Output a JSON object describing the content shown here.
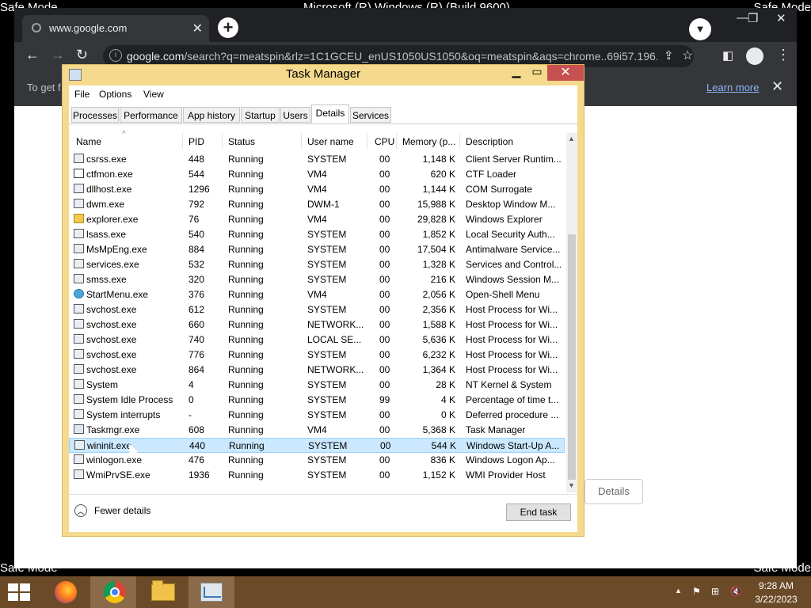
{
  "desktop": {
    "safe_mode": "Safe Mode",
    "build": "Microsoft (R) Windows (R) (Build 9600)"
  },
  "browser": {
    "tab_title": "www.google.com",
    "url_host": "google.com",
    "url_path": "/search?q=meatspin&rlz=1C1GCEU_enUS1050US1050&oq=meatspin&aqs=chrome..69i57.196...",
    "info_text": "To get f",
    "learn_more": "Learn more",
    "details_label": "Details"
  },
  "task_manager": {
    "title": "Task Manager",
    "menu": [
      "File",
      "Options",
      "View"
    ],
    "tabs": [
      "Processes",
      "Performance",
      "App history",
      "Startup",
      "Users",
      "Details",
      "Services"
    ],
    "active_tab": "Details",
    "columns": [
      "Name",
      "PID",
      "Status",
      "User name",
      "CPU",
      "Memory (p...",
      "Description"
    ],
    "rows": [
      {
        "name": "csrss.exe",
        "pid": "448",
        "status": "Running",
        "user": "SYSTEM",
        "cpu": "00",
        "mem": "1,148 K",
        "desc": "Client Server Runtim...",
        "icon": "exe-icon"
      },
      {
        "name": "ctfmon.exe",
        "pid": "544",
        "status": "Running",
        "user": "VM4",
        "cpu": "00",
        "mem": "620 K",
        "desc": "CTF Loader",
        "icon": "pencil-icon"
      },
      {
        "name": "dllhost.exe",
        "pid": "1296",
        "status": "Running",
        "user": "VM4",
        "cpu": "00",
        "mem": "1,144 K",
        "desc": "COM Surrogate",
        "icon": "exe-icon"
      },
      {
        "name": "dwm.exe",
        "pid": "792",
        "status": "Running",
        "user": "DWM-1",
        "cpu": "00",
        "mem": "15,988 K",
        "desc": "Desktop Window M...",
        "icon": "exe-icon"
      },
      {
        "name": "explorer.exe",
        "pid": "76",
        "status": "Running",
        "user": "VM4",
        "cpu": "00",
        "mem": "29,828 K",
        "desc": "Windows Explorer",
        "icon": "folder-icon"
      },
      {
        "name": "lsass.exe",
        "pid": "540",
        "status": "Running",
        "user": "SYSTEM",
        "cpu": "00",
        "mem": "1,852 K",
        "desc": "Local Security Auth...",
        "icon": "exe-icon"
      },
      {
        "name": "MsMpEng.exe",
        "pid": "884",
        "status": "Running",
        "user": "SYSTEM",
        "cpu": "00",
        "mem": "17,504 K",
        "desc": "Antimalware Service...",
        "icon": "exe-icon"
      },
      {
        "name": "services.exe",
        "pid": "532",
        "status": "Running",
        "user": "SYSTEM",
        "cpu": "00",
        "mem": "1,328 K",
        "desc": "Services and Control...",
        "icon": "exe-icon"
      },
      {
        "name": "smss.exe",
        "pid": "320",
        "status": "Running",
        "user": "SYSTEM",
        "cpu": "00",
        "mem": "216 K",
        "desc": "Windows Session M...",
        "icon": "exe-icon"
      },
      {
        "name": "StartMenu.exe",
        "pid": "376",
        "status": "Running",
        "user": "VM4",
        "cpu": "00",
        "mem": "2,056 K",
        "desc": "Open-Shell Menu",
        "icon": "globe-icon"
      },
      {
        "name": "svchost.exe",
        "pid": "612",
        "status": "Running",
        "user": "SYSTEM",
        "cpu": "00",
        "mem": "2,356 K",
        "desc": "Host Process for Wi...",
        "icon": "exe-icon"
      },
      {
        "name": "svchost.exe",
        "pid": "660",
        "status": "Running",
        "user": "NETWORK...",
        "cpu": "00",
        "mem": "1,588 K",
        "desc": "Host Process for Wi...",
        "icon": "exe-icon"
      },
      {
        "name": "svchost.exe",
        "pid": "740",
        "status": "Running",
        "user": "LOCAL SE...",
        "cpu": "00",
        "mem": "5,636 K",
        "desc": "Host Process for Wi...",
        "icon": "exe-icon"
      },
      {
        "name": "svchost.exe",
        "pid": "776",
        "status": "Running",
        "user": "SYSTEM",
        "cpu": "00",
        "mem": "6,232 K",
        "desc": "Host Process for Wi...",
        "icon": "exe-icon"
      },
      {
        "name": "svchost.exe",
        "pid": "864",
        "status": "Running",
        "user": "NETWORK...",
        "cpu": "00",
        "mem": "1,364 K",
        "desc": "Host Process for Wi...",
        "icon": "exe-icon"
      },
      {
        "name": "System",
        "pid": "4",
        "status": "Running",
        "user": "SYSTEM",
        "cpu": "00",
        "mem": "28 K",
        "desc": "NT Kernel & System",
        "icon": "exe-icon"
      },
      {
        "name": "System Idle Process",
        "pid": "0",
        "status": "Running",
        "user": "SYSTEM",
        "cpu": "99",
        "mem": "4 K",
        "desc": "Percentage of time t...",
        "icon": "exe-icon"
      },
      {
        "name": "System interrupts",
        "pid": "-",
        "status": "Running",
        "user": "SYSTEM",
        "cpu": "00",
        "mem": "0 K",
        "desc": "Deferred procedure ...",
        "icon": "exe-icon"
      },
      {
        "name": "Taskmgr.exe",
        "pid": "608",
        "status": "Running",
        "user": "VM4",
        "cpu": "00",
        "mem": "5,368 K",
        "desc": "Task Manager",
        "icon": "chart-icon"
      },
      {
        "name": "wininit.exe",
        "pid": "440",
        "status": "Running",
        "user": "SYSTEM",
        "cpu": "00",
        "mem": "544 K",
        "desc": "Windows Start-Up A...",
        "icon": "exe-icon",
        "selected": true
      },
      {
        "name": "winlogon.exe",
        "pid": "476",
        "status": "Running",
        "user": "SYSTEM",
        "cpu": "00",
        "mem": "836 K",
        "desc": "Windows Logon Ap...",
        "icon": "exe-icon"
      },
      {
        "name": "WmiPrvSE.exe",
        "pid": "1936",
        "status": "Running",
        "user": "SYSTEM",
        "cpu": "00",
        "mem": "1,152 K",
        "desc": "WMI Provider Host",
        "icon": "exe-icon"
      }
    ],
    "fewer_details": "Fewer details",
    "end_task": "End task"
  },
  "taskbar": {
    "time": "9:28 AM",
    "date": "3/22/2023"
  }
}
